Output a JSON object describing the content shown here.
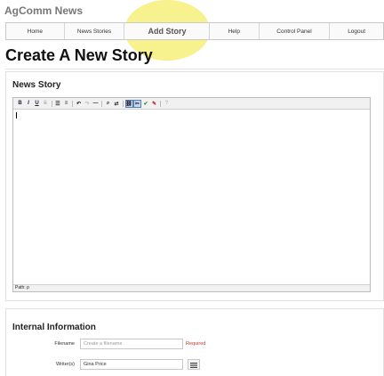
{
  "app": {
    "title": "AgComm News"
  },
  "nav": {
    "items": [
      {
        "label": "Home"
      },
      {
        "label": "News Stories"
      },
      {
        "label": "Add Story"
      },
      {
        "label": "Help"
      },
      {
        "label": "Control Panel"
      },
      {
        "label": "Logout"
      }
    ],
    "active": "Add Story",
    "highlight_color": "#f7f07a"
  },
  "page": {
    "title": "Create A New Story"
  },
  "news_story": {
    "heading": "News Story",
    "toolbar": {
      "buttons": [
        {
          "icon": "bold-icon",
          "glyph": "B"
        },
        {
          "icon": "italic-icon",
          "glyph": "I"
        },
        {
          "icon": "underline-icon",
          "glyph": "U"
        },
        {
          "icon": "strikethrough-icon",
          "glyph": "S"
        },
        {
          "icon": "bullet-list-icon",
          "glyph": "☰"
        },
        {
          "icon": "numbered-list-icon",
          "glyph": "≡"
        },
        {
          "icon": "undo-icon",
          "glyph": "↶"
        },
        {
          "icon": "redo-icon",
          "glyph": "↷"
        },
        {
          "icon": "horizontal-rule-icon",
          "glyph": "—"
        },
        {
          "icon": "find-icon",
          "glyph": "⌕"
        },
        {
          "icon": "replace-icon",
          "glyph": "⇄"
        },
        {
          "icon": "link-icon",
          "glyph": "⛓"
        },
        {
          "icon": "unlink-icon",
          "glyph": "✂"
        },
        {
          "icon": "spellcheck-icon",
          "glyph": "✔"
        },
        {
          "icon": "clean-icon",
          "glyph": "✎"
        },
        {
          "icon": "help-icon",
          "glyph": "?"
        }
      ]
    },
    "status_path": "Path: p"
  },
  "internal_information": {
    "heading": "Internal Information",
    "fields": {
      "filename": {
        "label": "Filename",
        "placeholder": "Create a filename",
        "value": "",
        "note": "Required"
      },
      "writers": {
        "label": "Writer(s)",
        "value": "Gina Price"
      }
    }
  }
}
